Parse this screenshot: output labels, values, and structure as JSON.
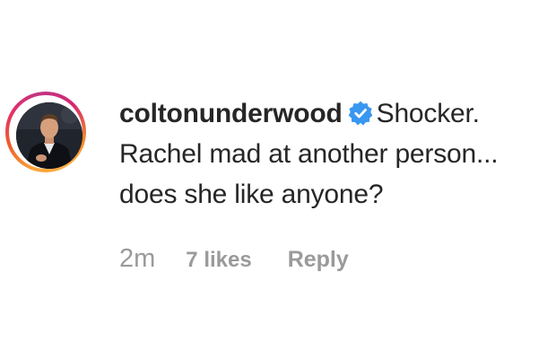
{
  "comment": {
    "username": "coltonunderwood",
    "verified": true,
    "verified_icon": "verified-badge-icon",
    "verified_color": "#3897f0",
    "text_line_1": "Shocker.",
    "text_line_2": "Rachel mad at another person...",
    "text_line_3": "does she like anyone?",
    "time": "2m",
    "likes": "7 likes",
    "reply_label": "Reply"
  },
  "avatar": {
    "icon": "profile-photo",
    "story_ring_colors": [
      "#f58529",
      "#dd2a7b",
      "#8134af"
    ]
  }
}
